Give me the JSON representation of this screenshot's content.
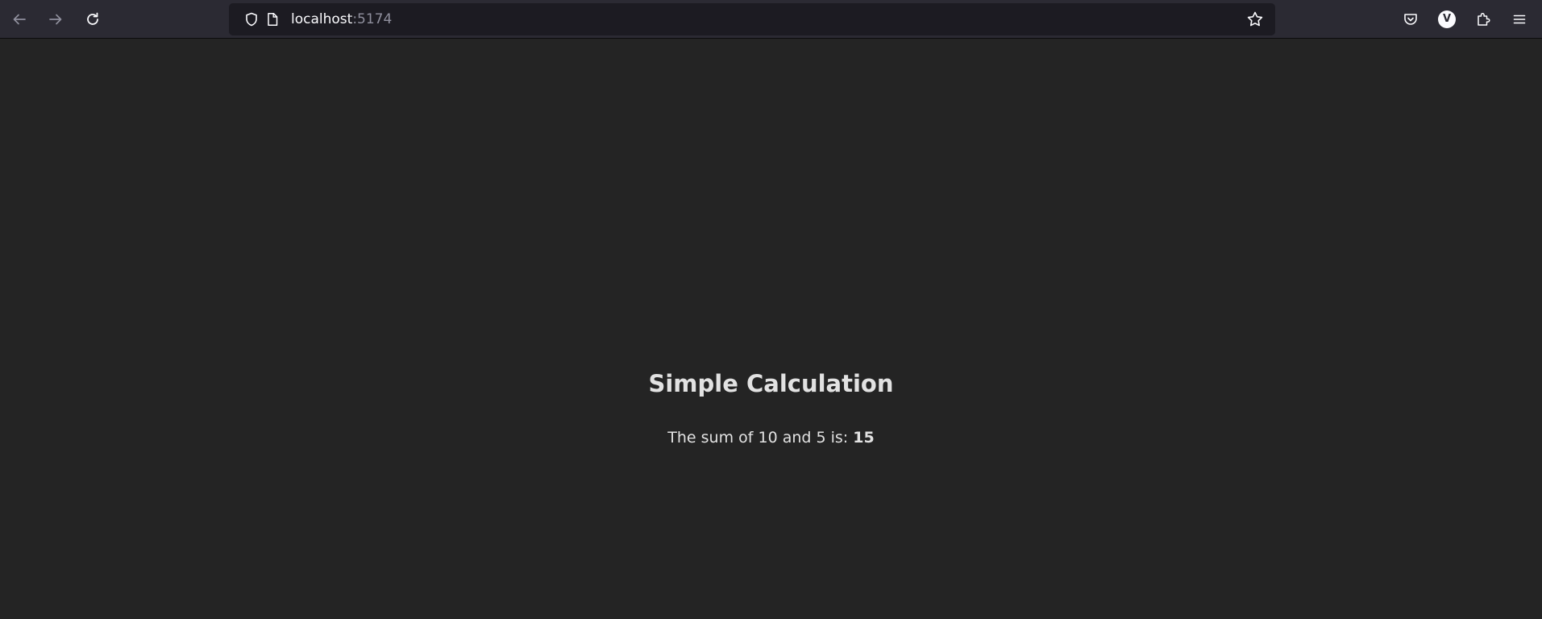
{
  "browser": {
    "url": {
      "host": "localhost",
      "port": ":5174"
    },
    "profile_initial": "V",
    "icons": {
      "back": "arrow-left-icon",
      "forward": "arrow-right-icon",
      "reload": "reload-icon",
      "tracking_protection": "shield-icon",
      "page_info": "page-icon",
      "bookmark": "star-icon",
      "pocket": "pocket-icon",
      "extensions": "puzzle-icon",
      "menu": "hamburger-icon"
    }
  },
  "page": {
    "title": "Simple Calculation",
    "sentence_prefix": "The sum of 10 and 5 is: ",
    "result": "15"
  },
  "colors": {
    "page_background": "#242424",
    "toolbar_background": "#2b2a33",
    "urlbar_background": "#1c1b22"
  }
}
